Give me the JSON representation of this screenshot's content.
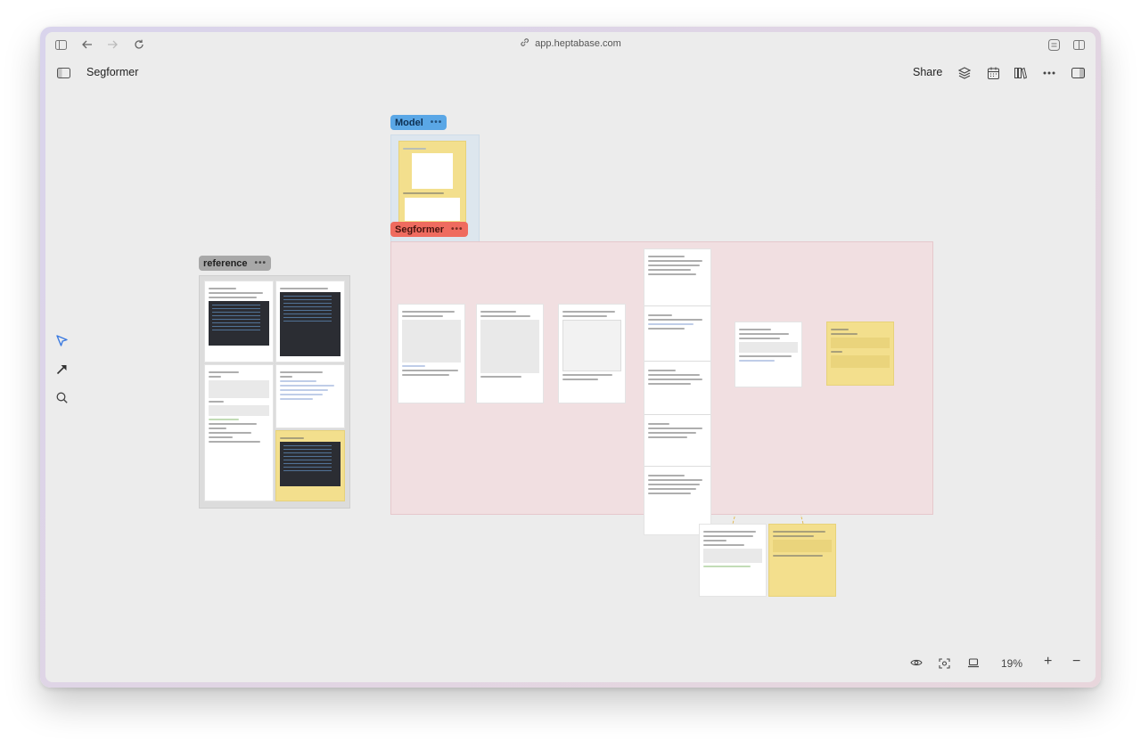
{
  "browser": {
    "url": "app.heptabase.com"
  },
  "app": {
    "title": "Segformer",
    "share_label": "Share"
  },
  "canvas": {
    "groups": {
      "model": {
        "label": "Model"
      },
      "segformer": {
        "label": "Segformer"
      },
      "reference": {
        "label": "reference"
      }
    },
    "more_label": "•••"
  },
  "zoom": {
    "level": "19%",
    "plus_label": "+",
    "minus_label": "−"
  },
  "colors": {
    "model_tag": "#5aa7e6",
    "segformer_tag": "#ef6b5f",
    "reference_tag": "#a8a8a8",
    "segformer_area": "#f1dfe1",
    "model_area": "#dde6ee",
    "yellow_card": "#f3df8d",
    "accent": "#3b7ae0"
  },
  "icons": {
    "sidebar_toggle": "sidebar-icon",
    "back": "back-arrow-icon",
    "forward": "forward-arrow-icon",
    "reload": "reload-icon",
    "link": "link-icon",
    "layers": "layers-icon",
    "calendar": "calendar-icon",
    "library": "library-icon",
    "more": "more-icon",
    "right_panel": "right-panel-icon",
    "select": "cursor-icon",
    "connect": "arrow-icon",
    "search": "search-icon",
    "eye": "eye-icon",
    "focus": "focus-icon",
    "laptop": "laptop-icon"
  }
}
